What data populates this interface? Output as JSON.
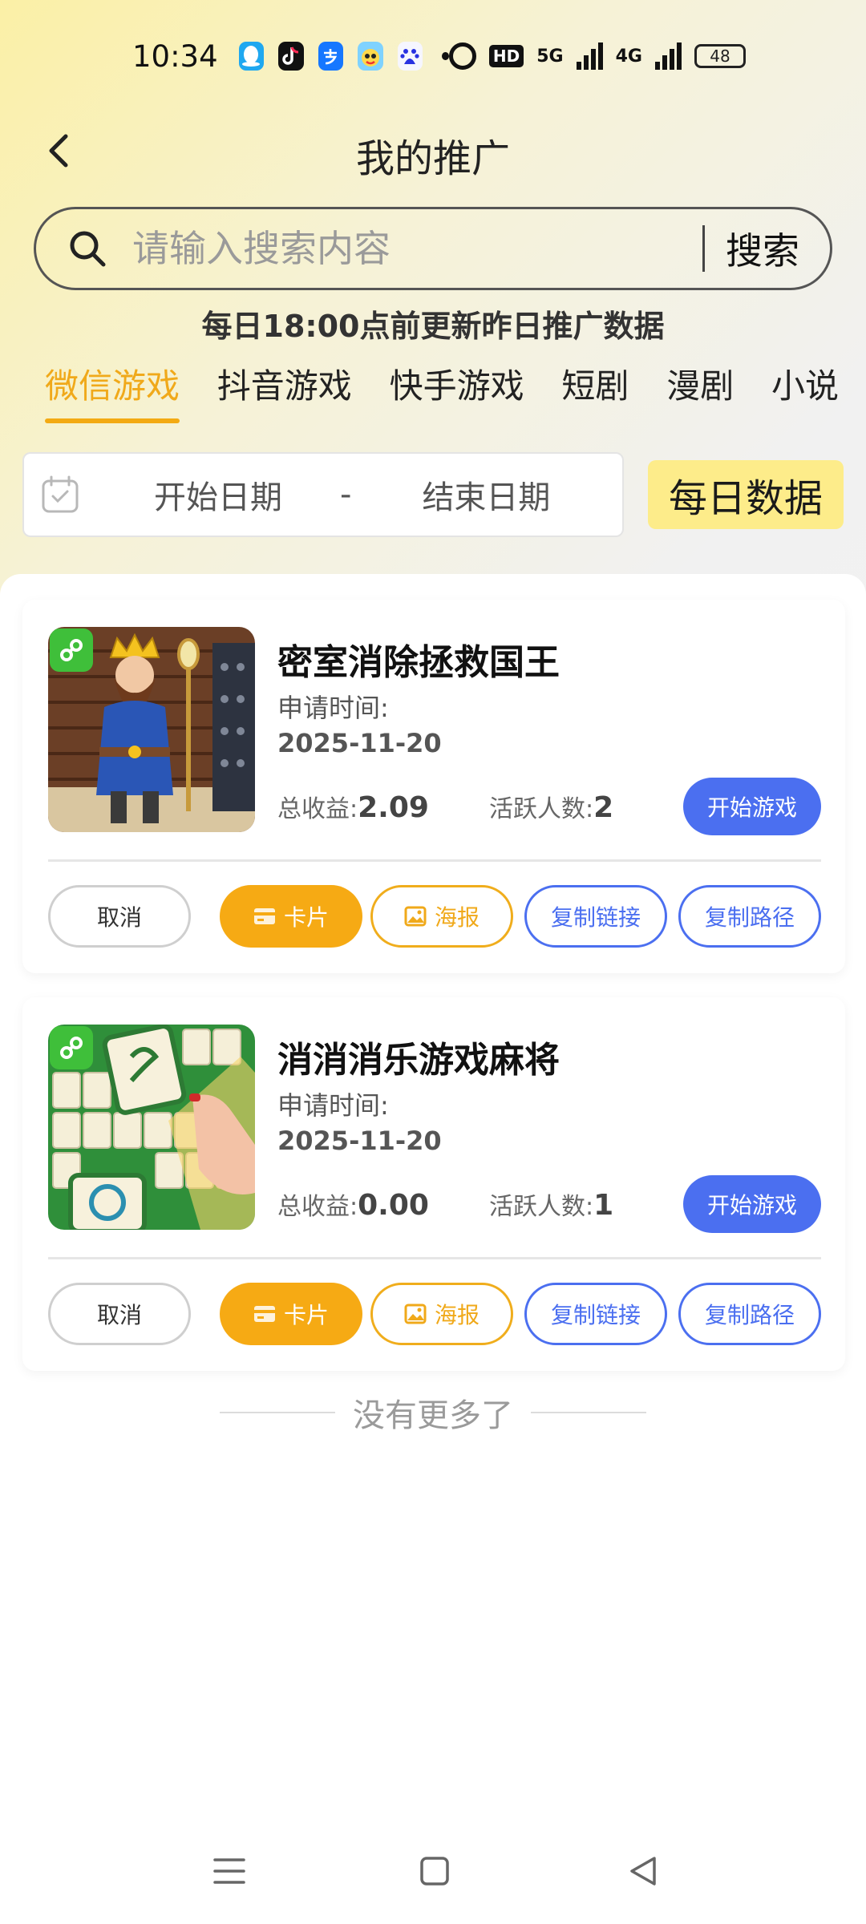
{
  "status_bar": {
    "time": "10:34",
    "hd_label": "HD",
    "network_1": "5G",
    "network_2": "4G",
    "battery": "48"
  },
  "header": {
    "title": "我的推广"
  },
  "search": {
    "placeholder": "请输入搜索内容",
    "button_label": "搜索"
  },
  "notice": "每日18:00点前更新昨日推广数据",
  "tabs": [
    {
      "label": "微信游戏",
      "active": true
    },
    {
      "label": "抖音游戏",
      "active": false
    },
    {
      "label": "快手游戏",
      "active": false
    },
    {
      "label": "短剧",
      "active": false
    },
    {
      "label": "漫剧",
      "active": false
    },
    {
      "label": "小说",
      "active": false
    }
  ],
  "date_filter": {
    "start_placeholder": "开始日期",
    "separator": "-",
    "end_placeholder": "结束日期",
    "daily_button": "每日数据"
  },
  "games": [
    {
      "name": "密室消除拯救国王",
      "apply_label": "申请时间:",
      "apply_date": "2025-11-20",
      "income_label": "总收益:",
      "income_value": "2.09",
      "active_label": "活跃人数:",
      "active_value": "2",
      "start_button": "开始游戏",
      "cancel_button": "取消",
      "card_button": "卡片",
      "poster_button": "海报",
      "copy_link_button": "复制链接",
      "copy_path_button": "复制路径"
    },
    {
      "name": "消消消乐游戏麻将",
      "apply_label": "申请时间:",
      "apply_date": "2025-11-20",
      "income_label": "总收益:",
      "income_value": "0.00",
      "active_label": "活跃人数:",
      "active_value": "1",
      "start_button": "开始游戏",
      "cancel_button": "取消",
      "card_button": "卡片",
      "poster_button": "海报",
      "copy_link_button": "复制链接",
      "copy_path_button": "复制路径"
    }
  ],
  "list_footer": "没有更多了",
  "colors": {
    "accent_yellow": "#f3aa13",
    "primary_blue": "#4b6ff0",
    "daily_button_bg": "#fdec8a"
  }
}
